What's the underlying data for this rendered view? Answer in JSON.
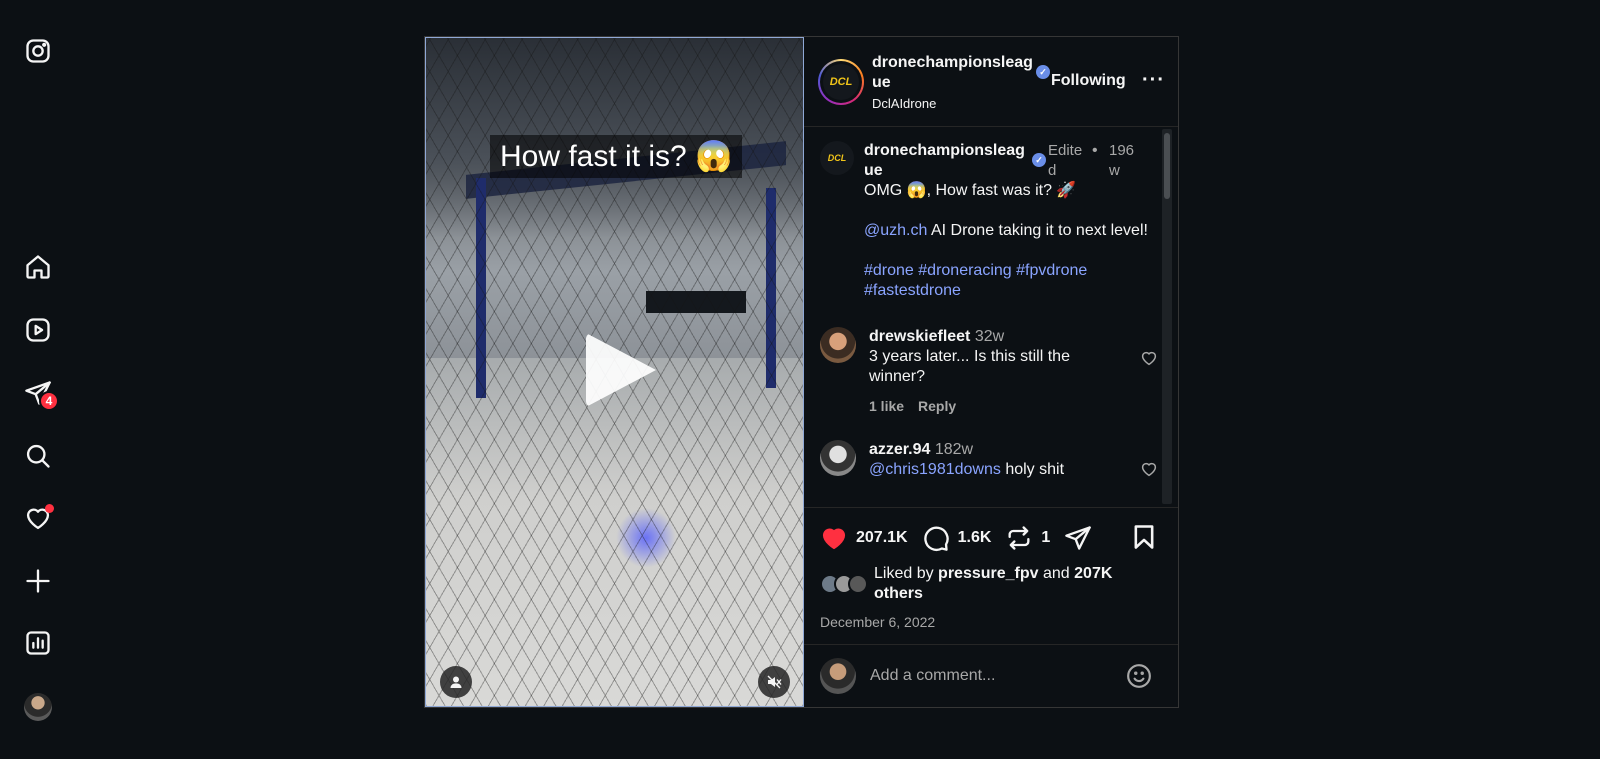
{
  "sidebar": {
    "items": [
      {
        "name": "instagram-icon"
      },
      {
        "name": "home-icon"
      },
      {
        "name": "reels-icon"
      },
      {
        "name": "messages-icon",
        "badge": "4"
      },
      {
        "name": "search-icon"
      },
      {
        "name": "notifications-icon"
      },
      {
        "name": "create-icon"
      },
      {
        "name": "dashboard-icon"
      }
    ]
  },
  "media": {
    "overlay_text": "How fast it is? 😱"
  },
  "header": {
    "username": "dronechampionsleague",
    "subname": "DclAIdrone",
    "verified_glyph": "✓",
    "following_label": "Following",
    "more_label": "···",
    "logo_text": "DCL"
  },
  "caption": {
    "username": "dronechampionsleague",
    "edited": "Edited",
    "separator": "•",
    "time": "196w",
    "line1": "OMG 😱, How fast was it? 🚀",
    "mention": "@uzh.ch",
    "line2_rest": " AI Drone taking it to next level!",
    "hashtags": "#drone #droneracing #fpvdrone #fastestdrone"
  },
  "comments": [
    {
      "username": "drewskiefleet",
      "time": "32w",
      "text": "3 years later... Is this still the winner?",
      "likes": "1 like",
      "reply": "Reply"
    },
    {
      "username": "azzer.94",
      "time": "182w",
      "mention": "@chris1981downs",
      "text": " holy shit"
    }
  ],
  "actions": {
    "likes": "207.1K",
    "comments": "1.6K",
    "reposts": "1",
    "liked_by_prefix": "Liked by",
    "liked_by_user": "pressure_fpv",
    "liked_by_and": " and ",
    "liked_by_others": "207K others",
    "date": "December 6, 2022"
  },
  "add_comment": {
    "placeholder": "Add a comment..."
  },
  "colors": {
    "background": "#0c1014",
    "like_red": "#ff3040",
    "link_blue": "#8aa4ff",
    "muted": "#a8a8a8"
  }
}
